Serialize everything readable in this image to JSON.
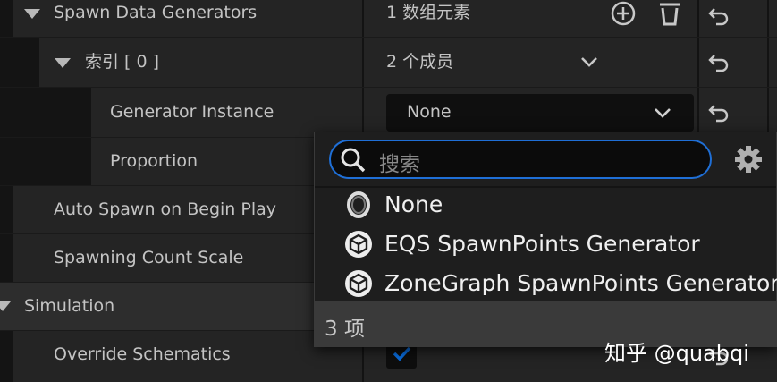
{
  "rows": {
    "spawn_data_generators": {
      "label": "Spawn Data Generators",
      "value": "1 数组元素"
    },
    "index0": {
      "label": "索引 [ 0 ]",
      "value": "2 个成员"
    },
    "generator_instance": {
      "label": "Generator Instance",
      "value": "None"
    },
    "proportion": {
      "label": "Proportion"
    },
    "auto_spawn": {
      "label": "Auto Spawn on Begin Play"
    },
    "spawning_count_scale": {
      "label": "Spawning Count Scale"
    },
    "simulation": {
      "label": "Simulation"
    },
    "override_schematics": {
      "label": "Override Schematics",
      "checked": true
    }
  },
  "popup": {
    "search_placeholder": "搜索",
    "options": [
      {
        "label": "None",
        "icon": "none-circle-icon"
      },
      {
        "label": "EQS SpawnPoints Generator",
        "icon": "cube-icon"
      },
      {
        "label": "ZoneGraph SpawnPoints Generator",
        "icon": "cube-icon"
      }
    ],
    "count_label": "3 项"
  },
  "watermark": "知乎 @quabqi",
  "colors": {
    "accent": "#1f6fd6",
    "panel": "#242424",
    "checkbox": "#0a55c8"
  }
}
